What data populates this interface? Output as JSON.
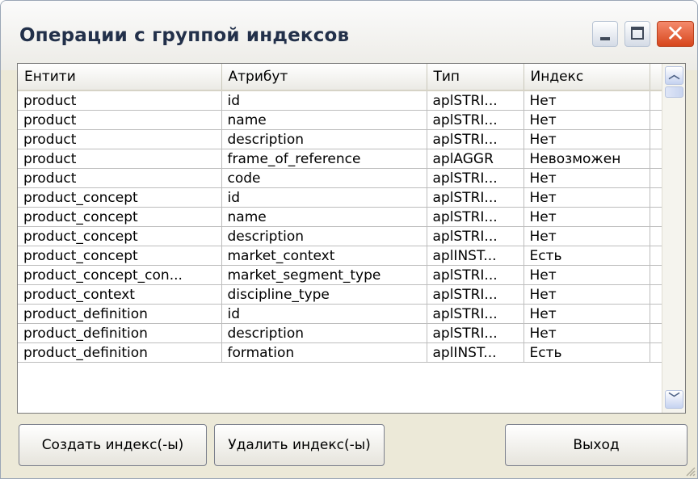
{
  "window": {
    "title": "Операции с группой индексов",
    "controls": {
      "minimize": "minimize-icon",
      "maximize": "maximize-icon",
      "close": "close-icon"
    }
  },
  "table": {
    "columns": [
      "Ентити",
      "Атрибут",
      "Тип",
      "Индекс"
    ],
    "rows": [
      [
        "product",
        "id",
        "aplSTRI...",
        "Нет"
      ],
      [
        "product",
        "name",
        "aplSTRI...",
        "Нет"
      ],
      [
        "product",
        "description",
        "aplSTRI...",
        "Нет"
      ],
      [
        "product",
        "frame_of_reference",
        "aplAGGR",
        "Невозможен"
      ],
      [
        "product",
        "code",
        "aplSTRI...",
        "Нет"
      ],
      [
        "product_concept",
        "id",
        "aplSTRI...",
        "Нет"
      ],
      [
        "product_concept",
        "name",
        "aplSTRI...",
        "Нет"
      ],
      [
        "product_concept",
        "description",
        "aplSTRI...",
        "Нет"
      ],
      [
        "product_concept",
        "market_context",
        "aplINST...",
        "Есть"
      ],
      [
        "product_concept_con...",
        "market_segment_type",
        "aplSTRI...",
        "Нет"
      ],
      [
        "product_context",
        "discipline_type",
        "aplSTRI...",
        "Нет"
      ],
      [
        "product_definition",
        "id",
        "aplSTRI...",
        "Нет"
      ],
      [
        "product_definition",
        "description",
        "aplSTRI...",
        "Нет"
      ],
      [
        "product_definition",
        "formation",
        "aplINST...",
        "Есть"
      ]
    ]
  },
  "buttons": {
    "create": "Создать индекс(-ы)",
    "delete": "Удалить индекс(-ы)",
    "exit": "Выход"
  },
  "colors": {
    "window_bg": "#ece9d8",
    "close_button": "#d7461c",
    "title_text": "#22304a"
  }
}
